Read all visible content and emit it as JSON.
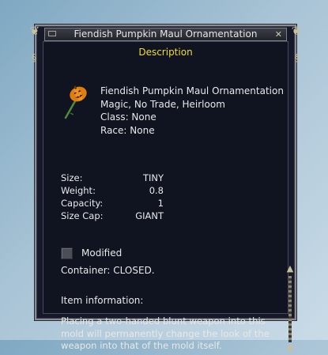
{
  "window": {
    "title": "Fiendish Pumpkin Maul Ornamentation",
    "section_label": "Description"
  },
  "item": {
    "name": "Fiendish Pumpkin Maul Ornamentation",
    "flags": "Magic, No Trade, Heirloom",
    "class_line": "Class: None",
    "race_line": "Race: None",
    "icon": "pumpkin-maul-icon"
  },
  "stats": [
    {
      "label": "Size:",
      "value": "TINY"
    },
    {
      "label": "Weight:",
      "value": "0.8"
    },
    {
      "label": "Capacity:",
      "value": "1"
    },
    {
      "label": "Size Cap:",
      "value": "GIANT"
    }
  ],
  "modified_label": "Modified",
  "container_status": "Container: CLOSED.",
  "item_information": {
    "heading": "Item information:",
    "text": "Placing a two-handed blunt weapon into this mold will permanently change the look of the weapon into that of the mold itself."
  },
  "colors": {
    "accent_yellow": "#f3dd2a",
    "window_bg": "#101421",
    "text": "#e8e8e8"
  }
}
